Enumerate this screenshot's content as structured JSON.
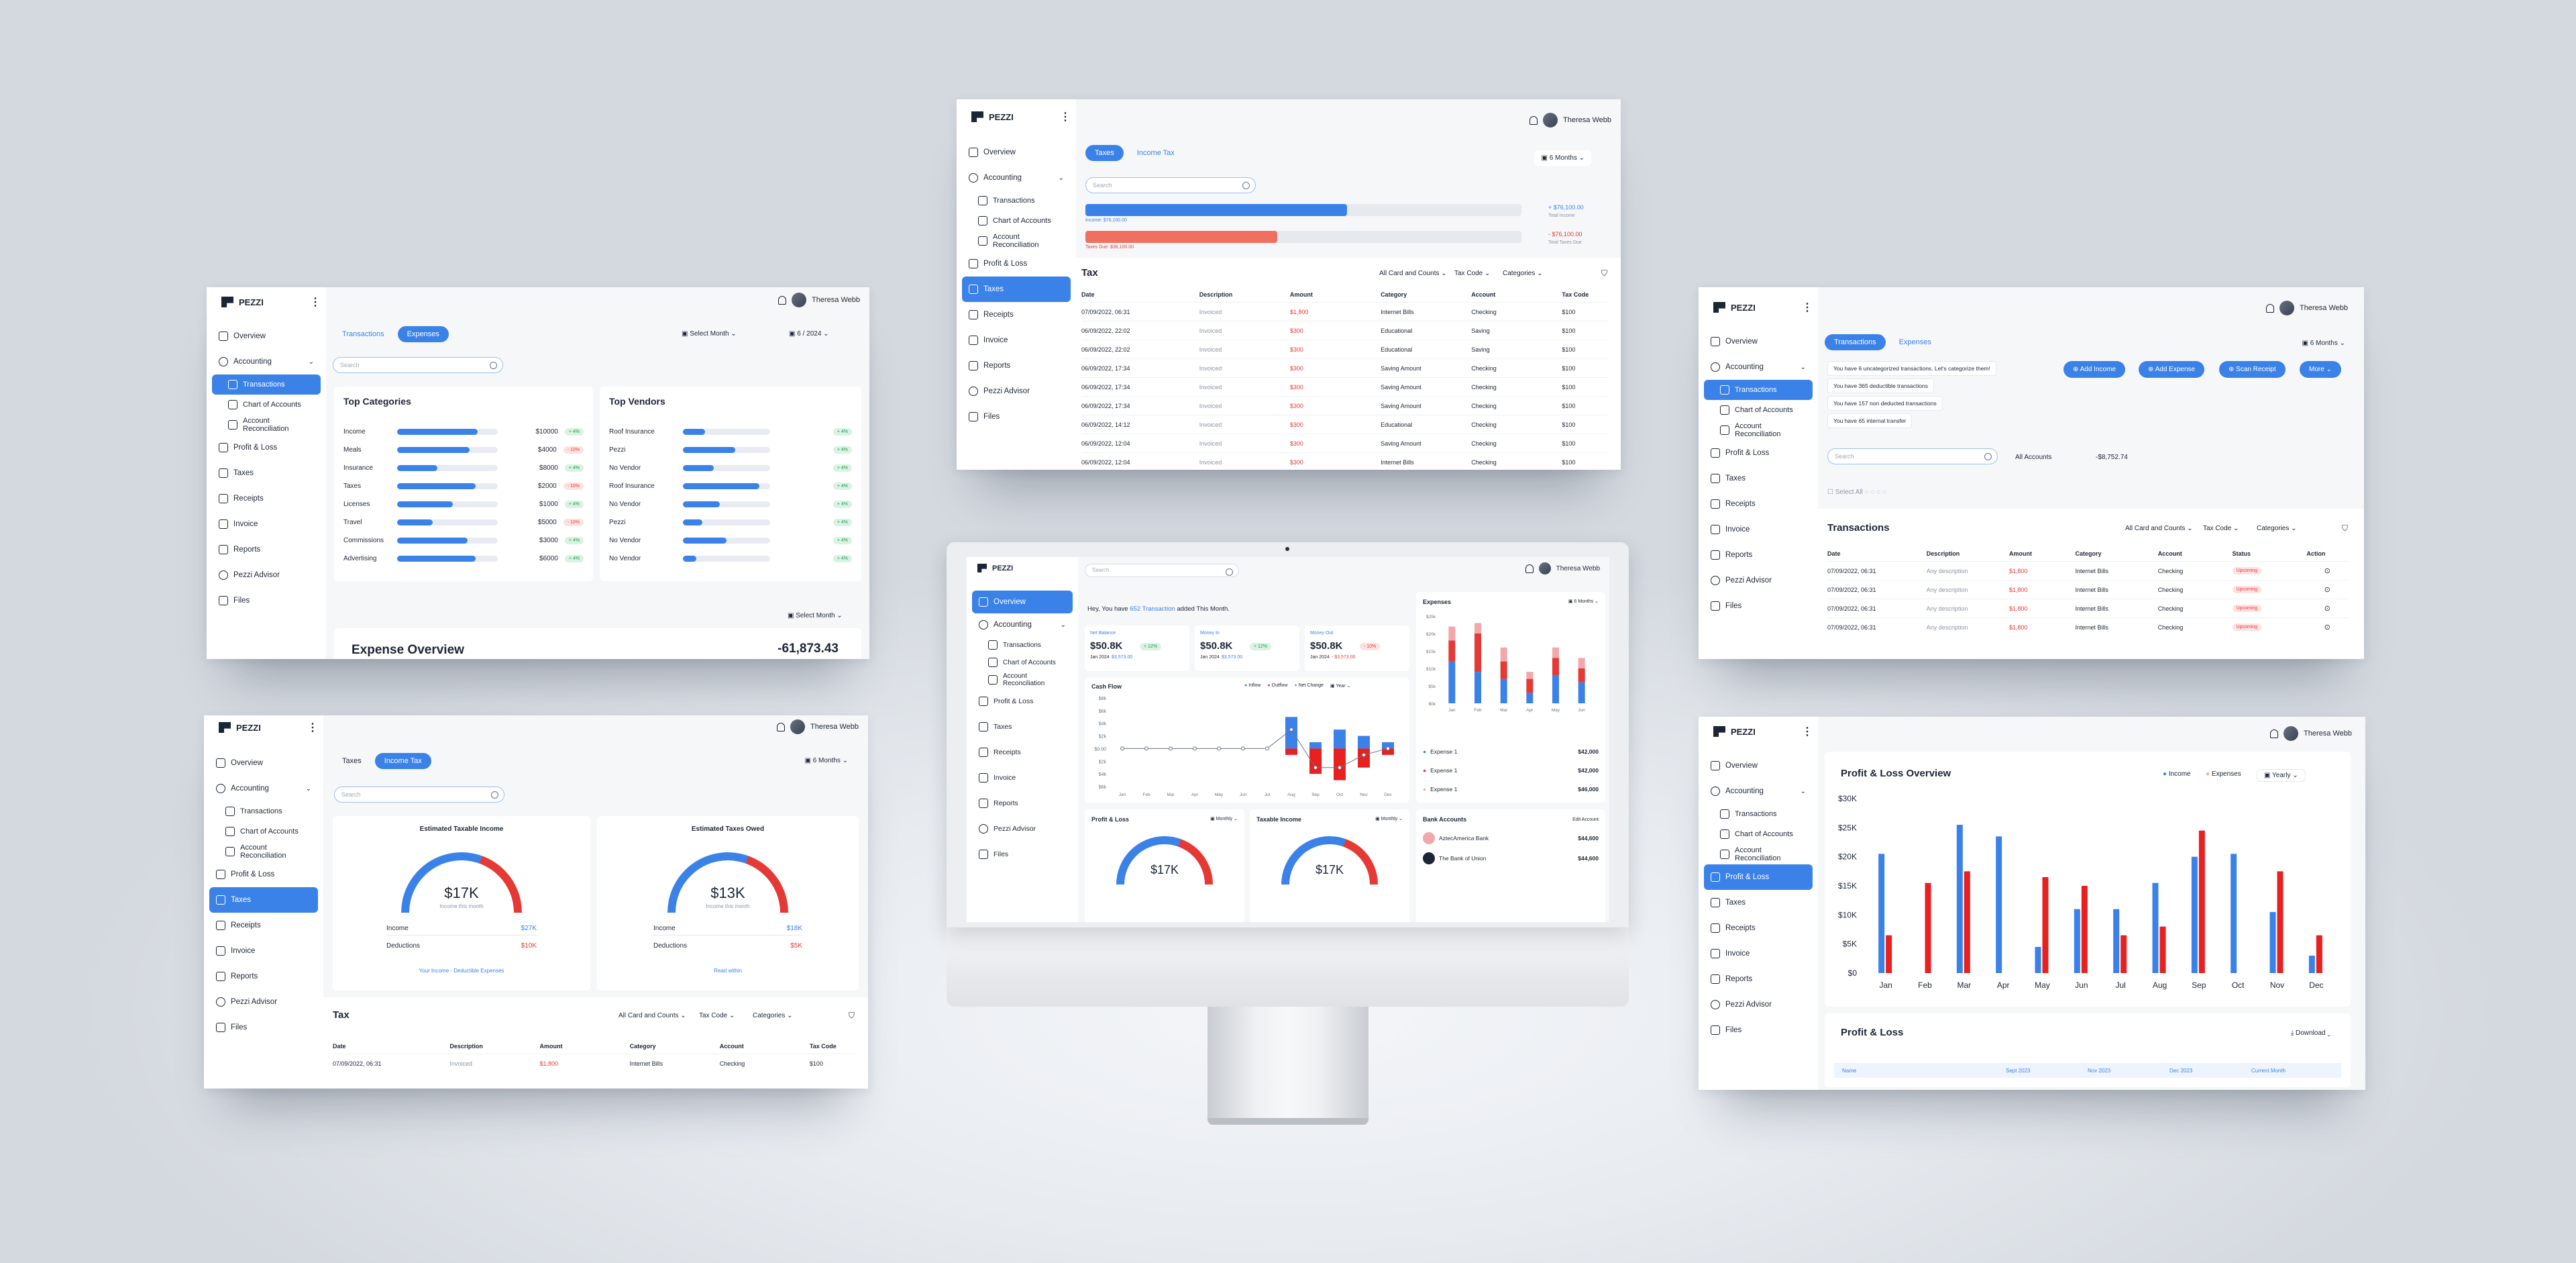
{
  "brand": {
    "name": "PEZZI",
    "user": "Theresa Webb"
  },
  "nav": {
    "overview": "Overview",
    "accounting": "Accounting",
    "transactions": "Transactions",
    "chart_of_accounts": "Chart of Accounts",
    "account_reconciliation": "Account Reconciliation",
    "profit_loss": "Profit & Loss",
    "taxes": "Taxes",
    "receipts": "Receipts",
    "invoice": "Invoice",
    "reports": "Reports",
    "advisor": "Pezzi Advisor",
    "files": "Files"
  },
  "search_placeholder": "Search",
  "expenses_panel": {
    "tabs": [
      "Transactions",
      "Expenses"
    ],
    "select_month": "Select Month",
    "period": "6 / 2024",
    "top_categories": {
      "title": "Top Categories",
      "rows": [
        {
          "label": "Income",
          "value": "$10000",
          "pill": "+ 4%",
          "fill": 0.8,
          "up": true
        },
        {
          "label": "Meals",
          "value": "$4000",
          "pill": "- 10%",
          "fill": 0.72,
          "up": false
        },
        {
          "label": "Insurance",
          "value": "$8000",
          "pill": "+ 4%",
          "fill": 0.4,
          "up": true
        },
        {
          "label": "Taxes",
          "value": "$2000",
          "pill": "- 10%",
          "fill": 0.78,
          "up": false
        },
        {
          "label": "Licenses",
          "value": "$1000",
          "pill": "+ 4%",
          "fill": 0.55,
          "up": true
        },
        {
          "label": "Travel",
          "value": "$5000",
          "pill": "- 10%",
          "fill": 0.35,
          "up": false
        },
        {
          "label": "Commissions",
          "value": "$3000",
          "pill": "+ 4%",
          "fill": 0.7,
          "up": true
        },
        {
          "label": "Advertising",
          "value": "$6000",
          "pill": "+ 4%",
          "fill": 0.78,
          "up": true
        }
      ]
    },
    "top_vendors": {
      "title": "Top Vendors",
      "rows": [
        {
          "label": "Roof Insurance",
          "pill": "+ 4%",
          "fill": 0.25
        },
        {
          "label": "Pezzi",
          "pill": "+ 4%",
          "fill": 0.6
        },
        {
          "label": "No Vendor",
          "pill": "+ 4%",
          "fill": 0.35
        },
        {
          "label": "Roof Insurance",
          "pill": "+ 4%",
          "fill": 0.88
        },
        {
          "label": "No Vendor",
          "pill": "+ 4%",
          "fill": 0.42
        },
        {
          "label": "Pezzi",
          "pill": "+ 4%",
          "fill": 0.22
        },
        {
          "label": "No Vendor",
          "pill": "+ 4%",
          "fill": 0.5
        },
        {
          "label": "No Vendor",
          "pill": "+ 4%",
          "fill": 0.15
        }
      ]
    },
    "select_month_2": "Select Month",
    "expense_overview": "Expense Overview",
    "expense_total": "-61,873.43"
  },
  "taxes_top": {
    "tabs": [
      "Taxes",
      "Income Tax"
    ],
    "period": "6 Months",
    "income_value": "+ $76,100.00",
    "income_label": "Income: $76,100.00",
    "income_sub": "Total Income",
    "owed_value": "- $76,100.00",
    "owed_label": "Taxes Due: $36,100.00",
    "owed_sub": "Total Taxes Due",
    "income_fill": 0.6,
    "owed_fill": 0.44,
    "tax_title": "Tax",
    "filters": [
      "All Card and Counts",
      "Tax Code",
      "Categories"
    ],
    "columns": [
      "Date",
      "Description",
      "Amount",
      "Category",
      "Account",
      "Tax Code"
    ],
    "rows": [
      [
        "07/09/2022, 06:31",
        "Invoiced",
        "$1,800",
        "Internet Bills",
        "Checking",
        "$100"
      ],
      [
        "06/09/2022, 22:02",
        "Invoiced",
        "$300",
        "Educational",
        "Saving",
        "$100"
      ],
      [
        "06/09/2022, 22:02",
        "Invoiced",
        "$300",
        "Educational",
        "Saving",
        "$100"
      ],
      [
        "06/09/2022, 17:34",
        "Invoiced",
        "$300",
        "Saving Amount",
        "Checking",
        "$100"
      ],
      [
        "06/09/2022, 17:34",
        "Invoiced",
        "$300",
        "Saving Amount",
        "Checking",
        "$100"
      ],
      [
        "06/09/2022, 17:34",
        "Invoiced",
        "$300",
        "Saving Amount",
        "Checking",
        "$100"
      ],
      [
        "06/09/2022, 14:12",
        "Invoiced",
        "$300",
        "Educational",
        "Checking",
        "$100"
      ],
      [
        "06/09/2022, 12:04",
        "Invoiced",
        "$300",
        "Saving Amount",
        "Checking",
        "$100"
      ],
      [
        "06/09/2022, 12:04",
        "Invoiced",
        "$300",
        "Internet Bills",
        "Checking",
        "$100"
      ]
    ]
  },
  "transactions_panel": {
    "tabs": [
      "Transactions",
      "Expenses"
    ],
    "period": "6 Months",
    "notes": [
      "You have 6 uncategorized transactions. Let's categorize them!",
      "You have 365 deductible transactions",
      "You have 157 non deducted transactions",
      "You have 65 internal transfer"
    ],
    "buttons": [
      "Add Income",
      "Add Expense",
      "Scan Receipt",
      "More"
    ],
    "account_filter": "All Accounts",
    "account_amount": "-$8,752.74",
    "select_all": "Select All",
    "title": "Transactions",
    "filters": [
      "All Card and Counts",
      "Tax Code",
      "Categories"
    ],
    "columns": [
      "Date",
      "Description",
      "Amount",
      "Category",
      "Account",
      "Status",
      "Action"
    ],
    "rows": [
      [
        "07/09/2022, 06:31",
        "Any description",
        "$1,800",
        "Internet Bills",
        "Checking",
        "Upcoming"
      ],
      [
        "07/09/2022, 06:31",
        "Any description",
        "$1,800",
        "Internet Bills",
        "Checking",
        "Upcoming"
      ],
      [
        "07/09/2022, 06:31",
        "Any description",
        "$1,800",
        "Internet Bills",
        "Checking",
        "Upcoming"
      ],
      [
        "07/09/2022, 06:31",
        "Any description",
        "$1,800",
        "Internet Bills",
        "Checking",
        "Upcoming"
      ]
    ]
  },
  "income_tax_panel": {
    "tabs": [
      "Taxes",
      "Income Tax"
    ],
    "period": "6 Months",
    "taxable": {
      "title": "Estimated Taxable Income",
      "value": "$17K",
      "sub": "Income this month",
      "income_label": "Income",
      "income_value": "$27K",
      "deductions_label": "Deductions",
      "deductions_value": "$10K",
      "link": "Your Income - Deductible Expenses"
    },
    "owed": {
      "title": "Estimated Taxes Owed",
      "value": "$13K",
      "sub": "Income this month",
      "income_label": "Income",
      "income_value": "$18K",
      "deductions_label": "Deductions",
      "deductions_value": "$5K",
      "link": "Read within"
    },
    "tax_title": "Tax",
    "filters": [
      "All Card and Counts",
      "Tax Code",
      "Categories"
    ],
    "columns": [
      "Date",
      "Description",
      "Amount",
      "Category",
      "Account",
      "Tax Code"
    ],
    "row": [
      "07/09/2022, 06:31",
      "Invoiced",
      "$1,800",
      "Internet Bills",
      "Checking",
      "$100"
    ]
  },
  "overview": {
    "greeting_pre": "Hey, You have",
    "greeting_link": "652 Transaction",
    "greeting_post": "added This Month.",
    "kpis": [
      {
        "label": "Net Balance",
        "value": "$50.8K",
        "badge": "+ 12%",
        "sub": "Jan 2024",
        "sub_val": "$3,573.00"
      },
      {
        "label": "Money In",
        "value": "$50.8K",
        "badge": "+ 12%",
        "sub": "Jan 2024",
        "sub_val": "$3,573.00"
      },
      {
        "label": "Money Out",
        "value": "$50.8K",
        "badge": "- 10%",
        "sub": "Jan 2024",
        "sub_val": "- $3,573.00"
      }
    ],
    "cashflow_title": "Cash Flow",
    "legend": [
      "Inflow",
      "Outflow",
      "Net Change",
      "Year"
    ],
    "cashflow_ticks": [
      "$8k",
      "$6k",
      "$4k",
      "$2k",
      "$0.00",
      "$2k",
      "$4k",
      "$6k"
    ],
    "months": [
      "Jan",
      "Feb",
      "Mar",
      "Apr",
      "May",
      "Jun",
      "Jul",
      "Aug",
      "Sep",
      "Oct",
      "Nov",
      "Dec"
    ],
    "expenses_title": "Expenses",
    "expenses_period": "6 Months",
    "exp_ticks": [
      "$25k",
      "$20k",
      "$15k",
      "$10k",
      "$5k",
      "$0k"
    ],
    "exp_months": [
      "Jan",
      "Feb",
      "Mar",
      "Apr",
      "May",
      "Jun"
    ],
    "expense_legend": [
      {
        "label": "Expense 1",
        "value": "$42,000",
        "color": "#3b82e8"
      },
      {
        "label": "Expense 1",
        "value": "$42,000",
        "color": "#e53935"
      },
      {
        "label": "Expense 1",
        "value": "$46,000",
        "color": "#f2a8a8"
      }
    ],
    "pl_title": "Profit & Loss",
    "pl_period": "Monthly",
    "ti_title": "Taxable Income",
    "ti_period": "Monthly",
    "pl_value": "$17K",
    "ti_value": "$17K",
    "bank_title": "Bank Accounts",
    "bank_edit": "Edit Account",
    "banks": [
      {
        "name": "AztecAmerica Bank",
        "value": "$44,600"
      },
      {
        "name": "The Bank of Union",
        "value": "$44,600"
      }
    ]
  },
  "pl_panel": {
    "title": "Profit & Loss Overview",
    "legend_income": "Income",
    "legend_expenses": "Expenses",
    "period": "Yearly",
    "y_ticks": [
      "$30K",
      "$25K",
      "$20K",
      "$15K",
      "$10K",
      "$5K",
      "$0"
    ],
    "section": "Profit & Loss",
    "download": "Download",
    "cols": [
      "Name",
      "Sept 2023",
      "Nov 2023",
      "Dec 2023",
      "Current Month"
    ]
  },
  "chart_data": [
    {
      "type": "bar",
      "title": "Profit & Loss Overview",
      "categories": [
        "Jan",
        "Feb",
        "Mar",
        "Apr",
        "May",
        "Jun",
        "Jul",
        "Aug",
        "Sep",
        "Oct",
        "Nov",
        "Dec"
      ],
      "ylim": [
        0,
        30000
      ],
      "series": [
        {
          "name": "Income",
          "values": [
            20500,
            0,
            25500,
            23500,
            4500,
            11000,
            11000,
            15500,
            20000,
            20500,
            10500,
            3000
          ]
        },
        {
          "name": "Expenses",
          "values": [
            6500,
            15500,
            17500,
            0,
            16500,
            15000,
            6500,
            8000,
            24500,
            0,
            17500,
            6500
          ]
        }
      ]
    },
    {
      "type": "bar",
      "title": "Cash Flow",
      "categories": [
        "Jan",
        "Feb",
        "Mar",
        "Apr",
        "May",
        "Jun",
        "Jul",
        "Aug",
        "Sep",
        "Oct",
        "Nov",
        "Dec"
      ],
      "ylim": [
        -6000,
        8000
      ],
      "series": [
        {
          "name": "Inflow",
          "values": [
            0,
            0,
            0,
            0,
            0,
            0,
            0,
            5000,
            1000,
            3000,
            2000,
            1000
          ]
        },
        {
          "name": "Outflow",
          "values": [
            0,
            0,
            0,
            0,
            0,
            0,
            0,
            -1000,
            -4000,
            -5000,
            -3000,
            -1000
          ]
        },
        {
          "name": "Net Change",
          "values": [
            0,
            0,
            0,
            0,
            0,
            0,
            0,
            3000,
            -3000,
            -3000,
            -1000,
            0
          ]
        }
      ]
    },
    {
      "type": "bar",
      "title": "Expenses",
      "categories": [
        "Jan",
        "Feb",
        "Mar",
        "Apr",
        "May",
        "Jun"
      ],
      "ylim": [
        0,
        25000
      ],
      "series": [
        {
          "values": [
            12000,
            9000,
            7000,
            3000,
            8000,
            6000
          ]
        },
        {
          "values": [
            6000,
            11000,
            5000,
            4000,
            5000,
            4000
          ]
        },
        {
          "values": [
            4000,
            3000,
            4000,
            2000,
            3000,
            3000
          ]
        }
      ]
    }
  ]
}
